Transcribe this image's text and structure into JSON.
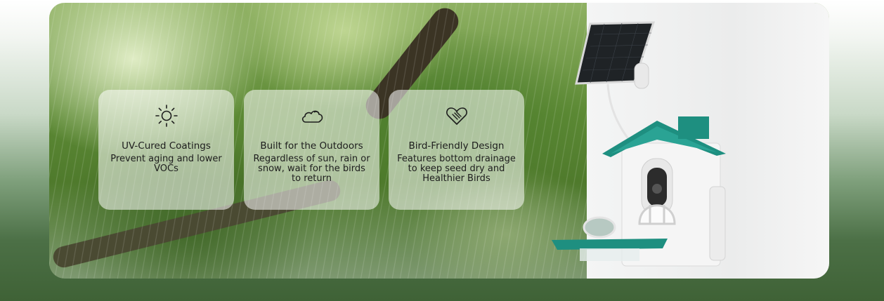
{
  "features": [
    {
      "icon": "sun-icon",
      "title": "UV-Cured Coatings",
      "desc": "Prevent aging and lower VOCs"
    },
    {
      "icon": "cloud-icon",
      "title": "Built for the Outdoors",
      "desc": "Regardless of sun, rain or snow, wait for the birds to return"
    },
    {
      "icon": "heart-hand-icon",
      "title": "Bird-Friendly Design",
      "desc": "Features bottom drainage to keep seed dry and Healthier Birds"
    }
  ],
  "colors": {
    "roof": "#1e8f80",
    "background_dark": "#3f6236",
    "card": "rgba(255,255,255,0.55)"
  }
}
